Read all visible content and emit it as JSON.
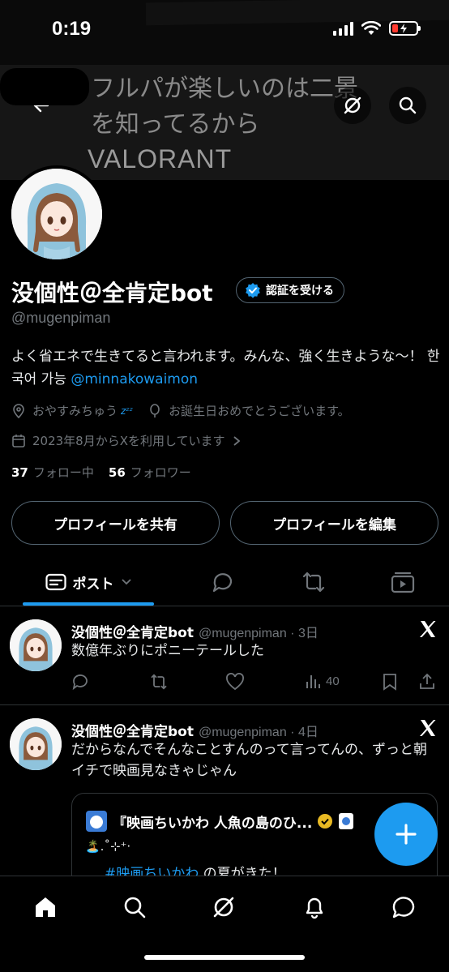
{
  "status_bar": {
    "time": "0:19"
  },
  "banner": {
    "line1": "フルパが楽しいのは二景",
    "line2": "を知ってるから",
    "line3": "VALORANT"
  },
  "profile": {
    "display_name": "没個性＠全肯定bot",
    "verify_label": "認証を受ける",
    "handle": "@mugenpiman",
    "bio_text": "よく省エネで生きてると言われます。みんな、強く生きような〜！ 한국어 가능 ",
    "bio_link": "@minnakowaimon",
    "location": "おやすみちゅう",
    "location_zzz": "zᶻᶻ",
    "birthday": "お誕生日おめでとうございます。",
    "joined": "2023年8月からXを利用しています",
    "following_count": "37",
    "following_label": "フォロー中",
    "followers_count": "56",
    "followers_label": "フォロワー",
    "share_button": "プロフィールを共有",
    "edit_button": "プロフィールを編集"
  },
  "tabs": {
    "posts_label": "ポスト"
  },
  "posts": [
    {
      "name": "没個性＠全肯定bot",
      "meta": "@mugenpiman · 3日",
      "text": "数億年ぶりにポニーテールした",
      "views": "40"
    },
    {
      "name": "没個性＠全肯定bot",
      "meta": "@mugenpiman · 4日",
      "text": "だからなんでそんなことすんのって言ってんの、ずっと朝イチで映画見なきゃじゃん",
      "quote": {
        "name": "『映画ちいかわ 人魚の島のひ...",
        "line2": "🏝️.˚⊹⁺‧",
        "hashtag": "#映画ちいかわ",
        "line3_rest": " の夏がきた！"
      }
    }
  ],
  "colors": {
    "accent": "#1d9bf0",
    "background": "#000000",
    "muted": "#71767b"
  }
}
